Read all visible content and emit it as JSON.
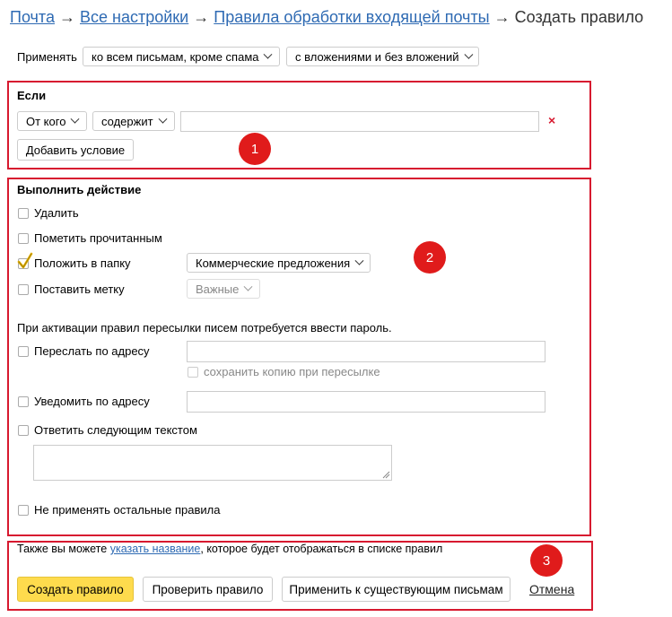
{
  "breadcrumb": {
    "items": [
      "Почта",
      "Все настройки",
      "Правила обработки входящей почты"
    ],
    "current": "Создать правило",
    "separator": "→"
  },
  "apply": {
    "label": "Применять",
    "scope_value": "ко всем письмам, кроме спама",
    "attachments_value": "с вложениями и без вложений"
  },
  "condition_section": {
    "title": "Если",
    "field_value": "От кого",
    "operator_value": "содержит",
    "value_input": "",
    "remove_icon": "×",
    "add_button": "Добавить условие",
    "badge": "1"
  },
  "actions_section": {
    "title": "Выполнить действие",
    "delete_label": "Удалить",
    "mark_read_label": "Пометить прочитанным",
    "move_label": "Положить в папку",
    "move_checked": true,
    "folder_value": "Коммерческие предложения",
    "label_label": "Поставить метку",
    "label_value": "Важные",
    "password_note": "При активации правил пересылки писем потребуется ввести пароль.",
    "forward_label": "Переслать по адресу",
    "keep_copy_label": "сохранить копию при пересылке",
    "notify_label": "Уведомить по адресу",
    "reply_label": "Ответить следующим текстом",
    "stop_label": "Не применять остальные правила",
    "badge": "2"
  },
  "footer": {
    "hint_before": "Также вы можете ",
    "hint_link": "указать название",
    "hint_after": ", которое будет отображаться в списке правил",
    "create_button": "Создать правило",
    "check_button": "Проверить правило",
    "apply_existing_button": "Применить к существующим письмам",
    "cancel_link": "Отмена",
    "badge": "3"
  },
  "colors": {
    "link": "#2e6ab3",
    "highlight_border": "#d7192f",
    "badge": "#e01b1b",
    "primary_button": "#fedb4d",
    "checkmark": "#e8b400"
  }
}
